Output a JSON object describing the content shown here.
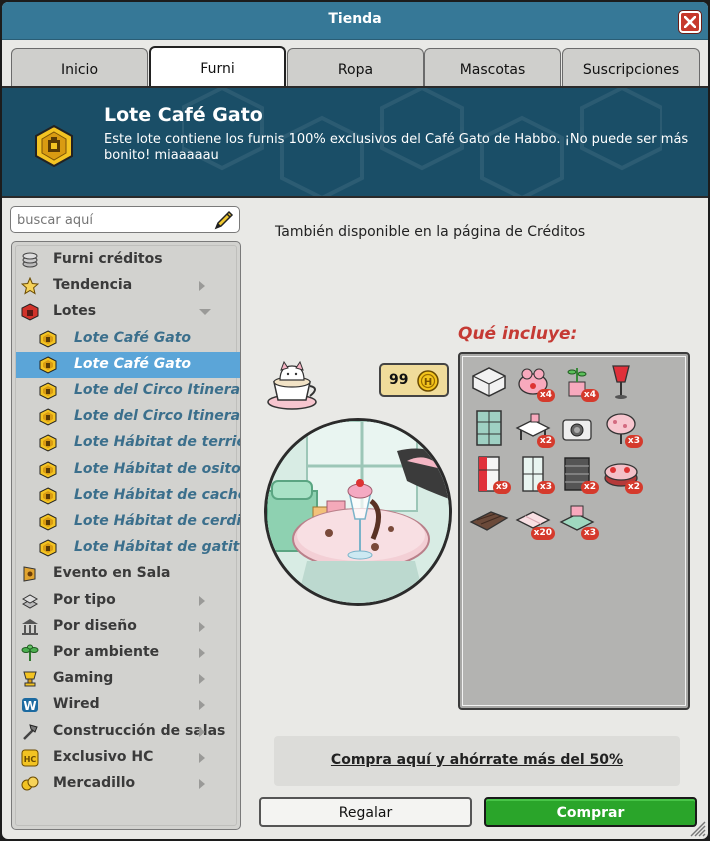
{
  "window": {
    "title": "Tienda"
  },
  "tabs": [
    {
      "label": "Inicio",
      "active": false
    },
    {
      "label": "Furni",
      "active": true
    },
    {
      "label": "Ropa",
      "active": false
    },
    {
      "label": "Mascotas",
      "active": false
    },
    {
      "label": "Suscripciones",
      "active": false
    }
  ],
  "banner": {
    "title": "Lote Café Gato",
    "description": "Este lote contiene los furnis 100% exclusivos del Café Gato de Habbo. ¡No puede ser más bonito! miaaaaau",
    "icon": "bundle-icon"
  },
  "search": {
    "placeholder": "buscar aquí",
    "icon": "pencil-icon"
  },
  "tree": [
    {
      "label": "Furni créditos",
      "icon": "coins-icon",
      "level": 0,
      "arrow": "none"
    },
    {
      "label": "Tendencia",
      "icon": "star-icon",
      "level": 0,
      "arrow": "right"
    },
    {
      "label": "Lotes",
      "icon": "bundle-red-icon",
      "level": 0,
      "arrow": "down"
    },
    {
      "label": "Lote Café Gato",
      "icon": "bundle-icon",
      "level": 1
    },
    {
      "label": "Lote Café Gato",
      "icon": "bundle-icon",
      "level": 1,
      "selected": true
    },
    {
      "label": "Lote del Circo Itinerante",
      "icon": "bundle-icon",
      "level": 1
    },
    {
      "label": "Lote del Circo Itinerante",
      "icon": "bundle-icon",
      "level": 1
    },
    {
      "label": "Lote Hábitat de terriers",
      "icon": "bundle-icon",
      "level": 1
    },
    {
      "label": "Lote Hábitat de osito pc",
      "icon": "bundle-icon",
      "level": 1
    },
    {
      "label": "Lote Hábitat de cachorr",
      "icon": "bundle-icon",
      "level": 1
    },
    {
      "label": "Lote Hábitat de cerditos",
      "icon": "bundle-icon",
      "level": 1
    },
    {
      "label": "Lote Hábitat de gatitos",
      "icon": "bundle-icon",
      "level": 1
    },
    {
      "label": "Evento en Sala",
      "icon": "event-icon",
      "level": 0,
      "arrow": "none"
    },
    {
      "label": "Por tipo",
      "icon": "type-icon",
      "level": 0,
      "arrow": "right"
    },
    {
      "label": "Por diseño",
      "icon": "design-icon",
      "level": 0,
      "arrow": "right"
    },
    {
      "label": "Por ambiente",
      "icon": "plant-icon",
      "level": 0,
      "arrow": "right"
    },
    {
      "label": "Gaming",
      "icon": "gaming-icon",
      "level": 0,
      "arrow": "right"
    },
    {
      "label": "Wired",
      "icon": "wired-icon",
      "level": 0,
      "arrow": "right"
    },
    {
      "label": "Construcción de salas",
      "icon": "build-icon",
      "level": 0,
      "arrow": "right"
    },
    {
      "label": "Exclusivo HC",
      "icon": "hc-icon",
      "level": 0,
      "arrow": "right"
    },
    {
      "label": "Mercadillo",
      "icon": "market-icon",
      "level": 0,
      "arrow": "right"
    }
  ],
  "main": {
    "availability": "También disponible en la página de Créditos",
    "includes_title": "Qué incluye:",
    "price": {
      "amount": "99",
      "currency_icon": "credit-coin-icon"
    },
    "items": [
      {
        "icon": "counter-furni-icon",
        "count": ""
      },
      {
        "icon": "cat-pink-icon",
        "count": "x4"
      },
      {
        "icon": "cat-plant-icon",
        "count": "x4"
      },
      {
        "icon": "red-lamp-icon",
        "count": ""
      },
      {
        "icon": "window-door-icon",
        "count": ""
      },
      {
        "icon": "cat-table-icon",
        "count": "x2"
      },
      {
        "icon": "cat-camera-icon",
        "count": ""
      },
      {
        "icon": "pink-lamp-icon",
        "count": "x3"
      },
      {
        "icon": "fridge-icon",
        "count": "x9"
      },
      {
        "icon": "window-icon",
        "count": "x3"
      },
      {
        "icon": "dark-window-icon",
        "count": "x2"
      },
      {
        "icon": "cake-icon",
        "count": "x2"
      },
      {
        "icon": "wood-plank-icon",
        "count": ""
      },
      {
        "icon": "floor-tile-icon",
        "count": "x20"
      },
      {
        "icon": "mint-bench-icon",
        "count": "x3"
      }
    ],
    "deal_link": "Compra aquí y ahórrate más del 50%",
    "gift_label": "Regalar",
    "buy_label": "Comprar"
  },
  "colors": {
    "titlebar": "#367897",
    "banner": "#1a4e67",
    "selected": "#5ba5d8",
    "buy": "#2aa52a",
    "includes": "#c53a34"
  }
}
